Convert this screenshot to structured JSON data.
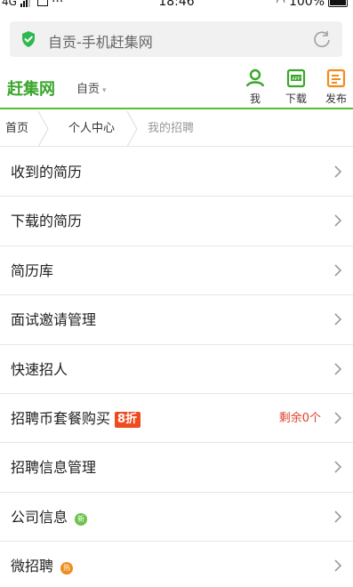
{
  "status_bar": {
    "network": "4G",
    "notification_icon": "notification-icon",
    "more": "···",
    "time": "18:46",
    "battery": "100%"
  },
  "address_bar": {
    "url_text": "自贡-手机赶集网",
    "secure_icon": "shield-check-icon",
    "reload_icon": "reload-icon"
  },
  "header": {
    "brand": "赶集网",
    "city": "自贡",
    "city_caret": "▾",
    "actions": [
      {
        "label": "我",
        "icon": "user-icon"
      },
      {
        "label": "下载",
        "icon": "app-download-icon"
      },
      {
        "label": "发布",
        "icon": "edit-post-icon"
      }
    ],
    "colors": {
      "brand": "#3aa62b",
      "accent_orange": "#f08c1c",
      "underline": "#5bbd2b"
    }
  },
  "breadcrumb": [
    "首页",
    "个人中心",
    "我的招聘"
  ],
  "menu": [
    {
      "title": "收到的简历"
    },
    {
      "title": "下载的简历"
    },
    {
      "title": "简历库"
    },
    {
      "title": "面试邀请管理"
    },
    {
      "title": "快速招人"
    },
    {
      "title": "招聘币套餐购买",
      "badge": "8折",
      "extra": "剩余0个"
    },
    {
      "title": "招聘信息管理"
    },
    {
      "title": "公司信息",
      "dot": "新"
    },
    {
      "title": "微招聘",
      "dot": "热"
    }
  ]
}
